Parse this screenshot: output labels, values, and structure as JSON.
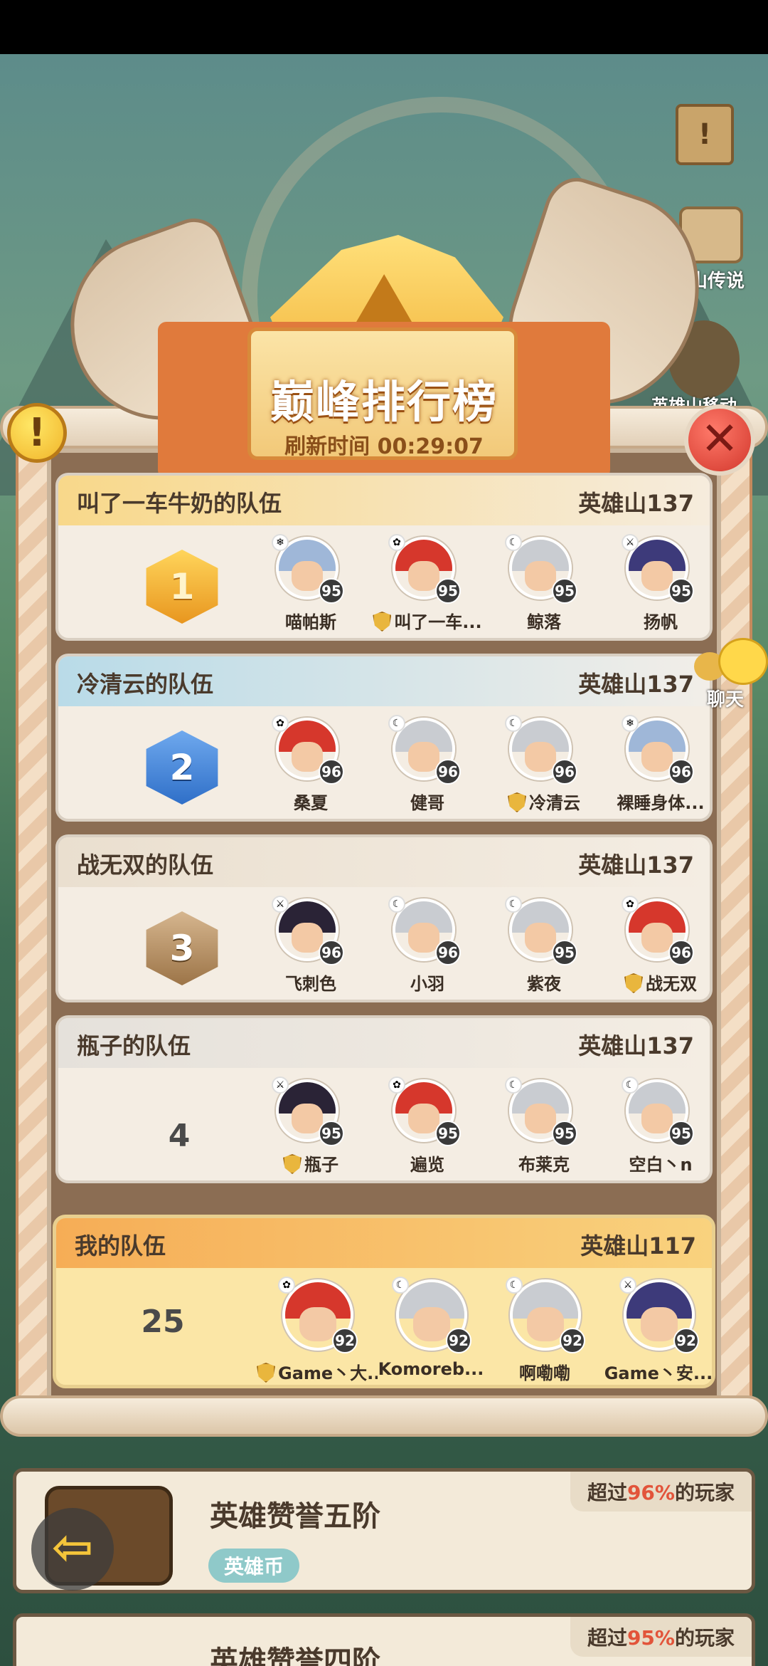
{
  "header": {
    "title": "巅峰排行榜",
    "refresh_label": "刷新时间 00:29:07"
  },
  "side": {
    "legend_label": "山传说",
    "hero_label": "英雄山移动"
  },
  "chat": {
    "label": "聊天"
  },
  "teams": [
    {
      "rank": "1",
      "name": "叫了一车牛奶的队伍",
      "mountain": "英雄山137",
      "heroes": [
        {
          "name": "喵帕斯",
          "level": "95",
          "captain": false
        },
        {
          "name": "叫了一车...",
          "level": "95",
          "captain": true
        },
        {
          "name": "鲸落",
          "level": "95",
          "captain": false
        },
        {
          "name": "扬帆",
          "level": "95",
          "captain": false
        }
      ]
    },
    {
      "rank": "2",
      "name": "冷清云的队伍",
      "mountain": "英雄山137",
      "heroes": [
        {
          "name": "桑夏",
          "level": "96",
          "captain": false
        },
        {
          "name": "健哥",
          "level": "96",
          "captain": false
        },
        {
          "name": "冷清云",
          "level": "96",
          "captain": true
        },
        {
          "name": "裸睡身体...",
          "level": "96",
          "captain": false
        }
      ]
    },
    {
      "rank": "3",
      "name": "战无双的队伍",
      "mountain": "英雄山137",
      "heroes": [
        {
          "name": "飞刺色",
          "level": "96",
          "captain": false
        },
        {
          "name": "小羽",
          "level": "96",
          "captain": false
        },
        {
          "name": "紫夜",
          "level": "95",
          "captain": false
        },
        {
          "name": "战无双",
          "level": "96",
          "captain": true
        }
      ]
    },
    {
      "rank": "4",
      "name": "瓶子的队伍",
      "mountain": "英雄山137",
      "heroes": [
        {
          "name": "瓶子",
          "level": "95",
          "captain": true
        },
        {
          "name": "遍览",
          "level": "95",
          "captain": false
        },
        {
          "name": "布莱克",
          "level": "95",
          "captain": false
        },
        {
          "name": "空白丶n",
          "level": "95",
          "captain": false
        }
      ]
    }
  ],
  "my_team": {
    "rank": "25",
    "name": "我的队伍",
    "mountain": "英雄山117",
    "heroes": [
      {
        "name": "Game丶大...",
        "level": "92",
        "captain": true
      },
      {
        "name": "Komoreb...",
        "level": "92",
        "captain": false
      },
      {
        "name": "啊嘞嘞",
        "level": "92",
        "captain": false
      },
      {
        "name": "Game丶安...",
        "level": "92",
        "captain": false
      }
    ]
  },
  "achievements": [
    {
      "title": "英雄赞誉五阶",
      "tag": "英雄币",
      "pct_prefix": "超过",
      "pct": "96%",
      "pct_suffix": "的玩家"
    },
    {
      "title": "英雄赞誉四阶",
      "pct_prefix": "超过",
      "pct": "95%",
      "pct_suffix": "的玩家"
    }
  ]
}
